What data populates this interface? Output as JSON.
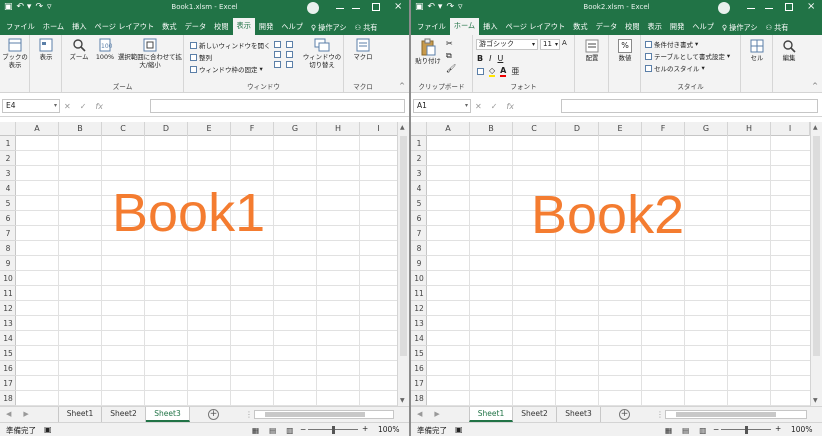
{
  "books": [
    {
      "file_title": "Book1.xlsm - Excel",
      "tabs": [
        "ファイル",
        "ホーム",
        "挿入",
        "ページ レイアウト",
        "数式",
        "データ",
        "校閲",
        "表示",
        "開発",
        "ヘルプ",
        "操作アシ",
        "共有"
      ],
      "active_tab": "表示",
      "namebox": "E4",
      "columns": [
        "A",
        "B",
        "C",
        "D",
        "E",
        "F",
        "G",
        "H",
        "I"
      ],
      "rows": [
        "1",
        "2",
        "3",
        "4",
        "5",
        "6",
        "7",
        "8",
        "9",
        "10",
        "11",
        "12",
        "13",
        "14",
        "15",
        "16",
        "17",
        "18"
      ],
      "big_label": "Book1",
      "sheets": [
        "Sheet1",
        "Sheet2",
        "Sheet3"
      ],
      "active_sheet": "Sheet3",
      "status_ready": "準備完了",
      "zoom": "100%",
      "ribbon": {
        "book_view": "ブックの表示",
        "show": "表示",
        "zoom": "ズーム",
        "zoom100": "100%",
        "zoom_selection": "選択範囲に合わせて拡大/縮小",
        "new_window": "新しいウィンドウを開く",
        "arrange": "整列",
        "freeze": "ウィンドウ枠の固定",
        "switch_window": "ウィンドウの切り替え",
        "macro": "マクロ",
        "group_zoom": "ズーム",
        "group_window": "ウィンドウ",
        "group_macro": "マクロ"
      }
    },
    {
      "file_title": "Book2.xlsm - Excel",
      "tabs": [
        "ファイル",
        "ホーム",
        "挿入",
        "ページ レイアウト",
        "数式",
        "データ",
        "校閲",
        "表示",
        "開発",
        "ヘルプ",
        "操作アシ",
        "共有"
      ],
      "active_tab": "ホーム",
      "namebox": "A1",
      "columns": [
        "A",
        "B",
        "C",
        "D",
        "E",
        "F",
        "G",
        "H",
        "I"
      ],
      "rows": [
        "1",
        "2",
        "3",
        "4",
        "5",
        "6",
        "7",
        "8",
        "9",
        "10",
        "11",
        "12",
        "13",
        "14",
        "15",
        "16",
        "17",
        "18"
      ],
      "big_label": "Book2",
      "sheets": [
        "Sheet1",
        "Sheet2",
        "Sheet3"
      ],
      "active_sheet": "Sheet1",
      "status_ready": "準備完了",
      "zoom": "100%",
      "ribbon": {
        "paste": "貼り付け",
        "clipboard": "クリップボード",
        "font_name": "游ゴシック",
        "font_size": "11",
        "font_group": "フォント",
        "align": "配置",
        "number": "数値",
        "percent": "%",
        "cond_format": "条件付き書式",
        "table_format": "テーブルとして書式設定",
        "cell_style": "セルのスタイル",
        "style_group": "スタイル",
        "cells": "セル",
        "edit": "編集",
        "bold": "B",
        "italic": "I",
        "underline": "U",
        "font_color_glyph": "A"
      }
    }
  ],
  "colors": {
    "excel_green": "#217346",
    "label_orange": "#f47c30"
  }
}
